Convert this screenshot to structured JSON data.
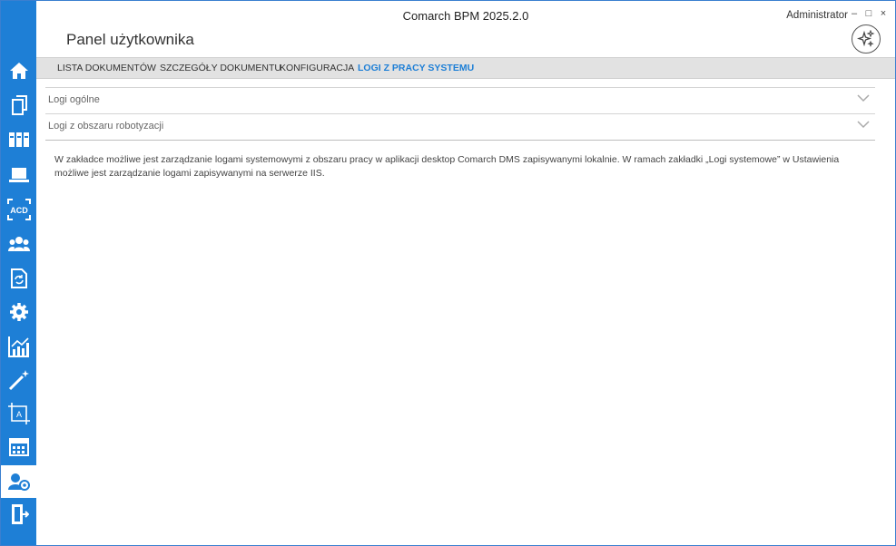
{
  "window": {
    "title": "Comarch BPM 2025.2.0",
    "user": "Administrator",
    "controls": [
      "–",
      "□",
      "×"
    ]
  },
  "panel": {
    "title": "Panel użytkownika",
    "ai_button_icon": "sparkles-icon"
  },
  "tabs": [
    {
      "label": "LISTA DOKUMENTÓW",
      "active": false
    },
    {
      "label": "SZCZEGÓŁY DOKUMENTU",
      "active": false
    },
    {
      "label": "KONFIGURACJA",
      "active": false
    },
    {
      "label": "LOGI Z PRACY SYSTEMU",
      "active": true
    }
  ],
  "sections": [
    {
      "label": "Logi ogólne"
    },
    {
      "label": "Logi z obszaru robotyzacji"
    }
  ],
  "description": "W zakładce możliwe jest zarządzanie logami systemowymi z obszaru pracy w aplikacji desktop Comarch DMS zapisywanymi lokalnie. W ramach zakładki „Logi systemowe” w Ustawienia możliwe jest zarządzanie logami zapisywanymi na serwerze IIS.",
  "sidebar": {
    "items": [
      {
        "icon": "home-icon"
      },
      {
        "icon": "documents-icon"
      },
      {
        "icon": "binders-icon"
      },
      {
        "icon": "laptop-icon"
      },
      {
        "icon": "acd-icon",
        "text": "ACD"
      },
      {
        "icon": "users-icon"
      },
      {
        "icon": "document-sync-icon"
      },
      {
        "icon": "gear-icon"
      },
      {
        "icon": "chart-icon"
      },
      {
        "icon": "magic-wand-icon"
      },
      {
        "icon": "crop-text-icon",
        "text": "A"
      },
      {
        "icon": "calendar-icon"
      },
      {
        "icon": "user-settings-icon",
        "active": true
      },
      {
        "icon": "exit-door-icon"
      }
    ]
  },
  "colors": {
    "accent": "#1e7fd6",
    "tab_bar": "#e2e2e2",
    "active_tab_text": "#1e7fd6"
  }
}
